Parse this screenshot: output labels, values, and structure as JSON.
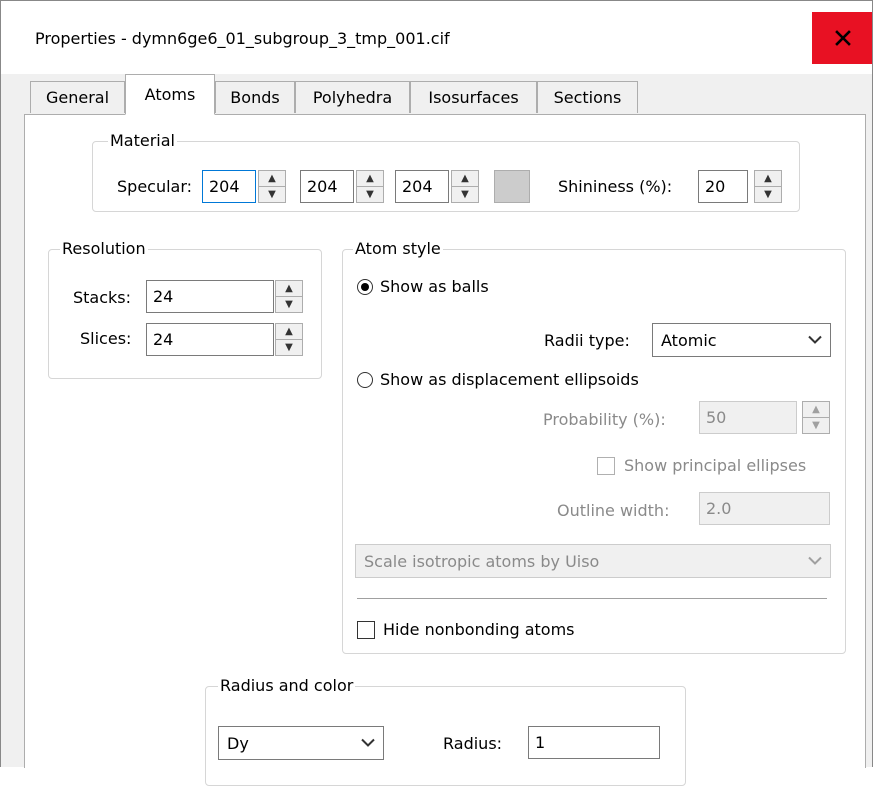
{
  "window": {
    "title": "Properties - dymn6ge6_01_subgroup_3_tmp_001.cif",
    "close_glyph": "✕"
  },
  "tabs": [
    {
      "label": "General"
    },
    {
      "label": "Atoms"
    },
    {
      "label": "Bonds"
    },
    {
      "label": "Polyhedra"
    },
    {
      "label": "Isosurfaces"
    },
    {
      "label": "Sections"
    }
  ],
  "material": {
    "legend": "Material",
    "specular_label": "Specular:",
    "r": "204",
    "g": "204",
    "b": "204",
    "swatch_color": "#cccccc",
    "shininess_label": "Shininess (%):",
    "shininess": "20"
  },
  "resolution": {
    "legend": "Resolution",
    "stacks_label": "Stacks:",
    "stacks": "24",
    "slices_label": "Slices:",
    "slices": "24"
  },
  "atom_style": {
    "legend": "Atom style",
    "balls_label": "Show as balls",
    "radii_type_label": "Radii type:",
    "radii_type": "Atomic",
    "ellipsoids_label": "Show as displacement ellipsoids",
    "probability_label": "Probability (%):",
    "probability": "50",
    "principal_label": "Show principal ellipses",
    "outline_label": "Outline width:",
    "outline": "2.0",
    "scale_option": "Scale isotropic atoms by Uiso",
    "hide_label": "Hide nonbonding atoms"
  },
  "radius_color": {
    "legend": "Radius and color",
    "element": "Dy",
    "radius_label": "Radius:",
    "radius": "1"
  }
}
